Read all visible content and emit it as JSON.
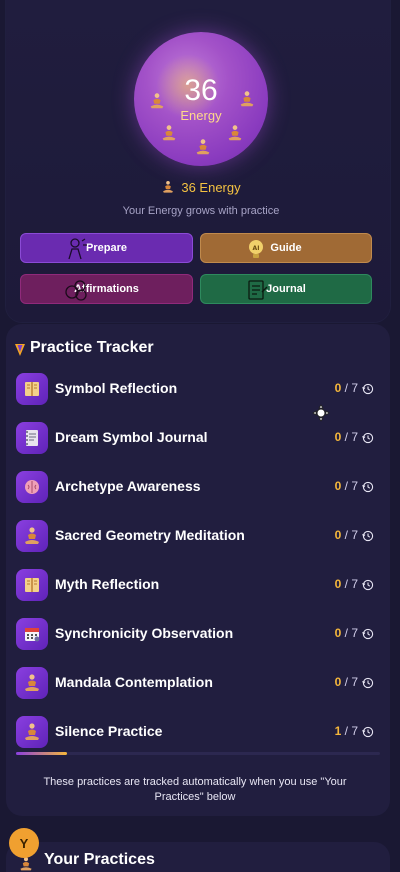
{
  "energy": {
    "value": "36",
    "orb_label": "Energy",
    "line": "36 Energy",
    "subtitle": "Your Energy grows with practice"
  },
  "actions": {
    "prepare": "Prepare",
    "guide": "Guide",
    "affirmations": "Affirmations",
    "journal": "Journal"
  },
  "tracker": {
    "title": "Practice Tracker",
    "items": [
      {
        "label": "Symbol Reflection",
        "done": "0",
        "total": " / 7",
        "icon": "book-icon"
      },
      {
        "label": "Dream Symbol Journal",
        "done": "0",
        "total": " / 7",
        "icon": "notebook-icon"
      },
      {
        "label": "Archetype Awareness",
        "done": "0",
        "total": " / 7",
        "icon": "brain-icon"
      },
      {
        "label": "Sacred Geometry Meditation",
        "done": "0",
        "total": " / 7",
        "icon": "meditation-icon"
      },
      {
        "label": "Myth Reflection",
        "done": "0",
        "total": " / 7",
        "icon": "book-icon"
      },
      {
        "label": "Synchronicity Observation",
        "done": "0",
        "total": " / 7",
        "icon": "calendar-icon"
      },
      {
        "label": "Mandala Contemplation",
        "done": "0",
        "total": " / 7",
        "icon": "meditation-icon"
      },
      {
        "label": "Silence Practice",
        "done": "1",
        "total": " / 7",
        "icon": "meditation-icon",
        "progress": 0.14
      }
    ],
    "note": "These practices are tracked automatically when you use \"Your Practices\" below"
  },
  "bottom": {
    "avatar_initial": "Y",
    "practices_title": "Your Practices"
  },
  "colors": {
    "background": "#1a1833",
    "accent_purple": "#8a3fe0",
    "accent_gold": "#f5b73b"
  }
}
